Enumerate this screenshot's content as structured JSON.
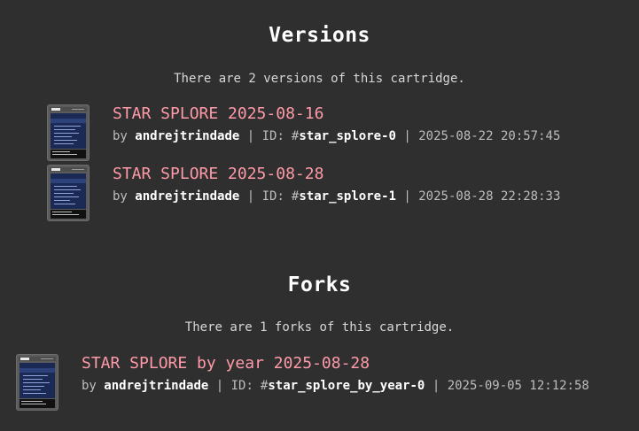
{
  "versions": {
    "heading": "Versions",
    "description": "There are 2 versions of this cartridge.",
    "items": [
      {
        "title": "STAR SPLORE 2025-08-16",
        "by": "by",
        "author": "andrejtrindade",
        "sep1": "|",
        "id_label": "ID:",
        "hash": "#",
        "id": "star_splore-0",
        "sep2": "|",
        "date": "2025-08-22 20:57:45"
      },
      {
        "title": "STAR SPLORE 2025-08-28",
        "by": "by",
        "author": "andrejtrindade",
        "sep1": "|",
        "id_label": "ID:",
        "hash": "#",
        "id": "star_splore-1",
        "sep2": "|",
        "date": "2025-08-28 22:28:33"
      }
    ]
  },
  "forks": {
    "heading": "Forks",
    "description": "There are 1 forks of this cartridge.",
    "items": [
      {
        "title": "STAR SPLORE by year 2025-08-28",
        "by": "by",
        "author": "andrejtrindade",
        "sep1": "|",
        "id_label": "ID:",
        "hash": "#",
        "id": "star_splore_by_year-0",
        "sep2": "|",
        "date": "2025-09-05 12:12:58"
      }
    ]
  },
  "icons": {
    "cartridge": "cartridge-thumbnail-icon"
  },
  "colors": {
    "background": "#2f2f2f",
    "title_link": "#ff9aa8",
    "heading": "#ffffff",
    "meta": "#bdbdbd"
  }
}
